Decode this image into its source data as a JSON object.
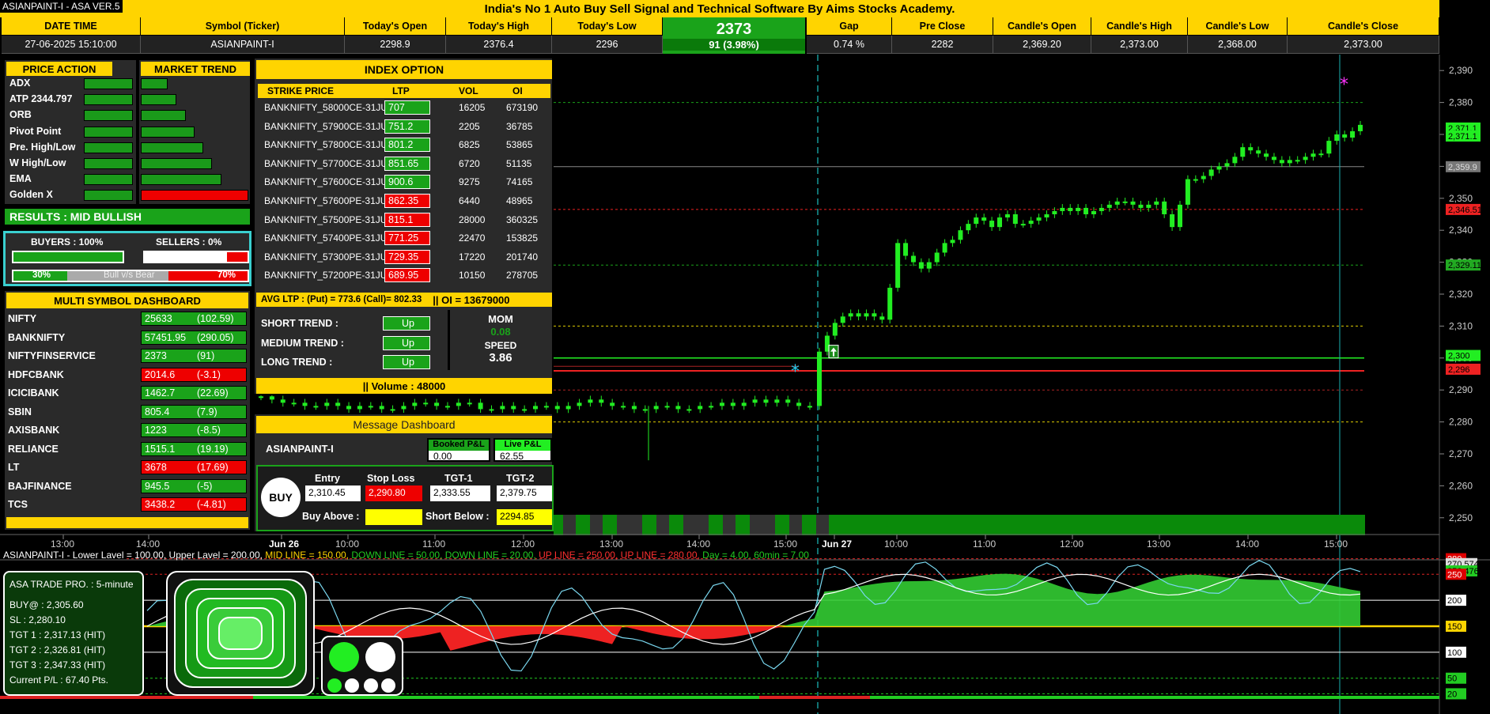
{
  "app": {
    "title": "ASIANPAINT-I - ASA VER.5",
    "banner": "India's No 1 Auto Buy Sell Signal and Technical Software By Aims Stocks Academy."
  },
  "quote": {
    "headers": [
      "DATE TIME",
      "Symbol (Ticker)",
      "Today's Open",
      "Today's High",
      "Today's Low",
      "Gap",
      "Pre Close",
      "Candle's Open",
      "Candle's High",
      "Candle's Low",
      "Candle's Close"
    ],
    "values": [
      "27-06-2025 15:10:00",
      "ASIANPAINT-I",
      "2298.9",
      "2376.4",
      "2296",
      "0.74 %",
      "2282",
      "2,369.20",
      "2,373.00",
      "2,368.00",
      "2,373.00"
    ],
    "ltp": "2373",
    "change": "91 (3.98%)"
  },
  "price_action": {
    "title": "PRICE ACTION",
    "items": [
      "ADX",
      "ATP 2344.797",
      "ORB",
      "Pivot Point",
      "Pre. High/Low",
      "W High/Low",
      "EMA",
      "Golden X"
    ]
  },
  "market_trend": {
    "title": "MARKET TREND",
    "levels": [
      0.25,
      0.33,
      0.42,
      0.5,
      0.58,
      0.66,
      0.75,
      1.0
    ]
  },
  "results": {
    "label": "RESULTS :  MID BULLISH"
  },
  "buyers_sellers": {
    "buyers": "BUYERS : 100%",
    "sellers": "SELLERS :  0%",
    "bull_pct": "30%",
    "bull_label": "Bull v/s Bear",
    "bear_pct": "70%"
  },
  "index_option": {
    "title": "INDEX OPTION",
    "headers": [
      "STRIKE PRICE",
      "LTP",
      "VOL",
      "OI"
    ],
    "rows": [
      {
        "strike": "BANKNIFTY_58000CE-31JU",
        "ltp": "707",
        "vol": "16205",
        "oi": "673190",
        "color": "g"
      },
      {
        "strike": "BANKNIFTY_57900CE-31JU",
        "ltp": "751.2",
        "vol": "2205",
        "oi": "36785",
        "color": "g"
      },
      {
        "strike": "BANKNIFTY_57800CE-31JU",
        "ltp": "801.2",
        "vol": "6825",
        "oi": "53865",
        "color": "g"
      },
      {
        "strike": "BANKNIFTY_57700CE-31JU",
        "ltp": "851.65",
        "vol": "6720",
        "oi": "51135",
        "color": "g"
      },
      {
        "strike": "BANKNIFTY_57600CE-31JU",
        "ltp": "900.6",
        "vol": "9275",
        "oi": "74165",
        "color": "g"
      },
      {
        "strike": "BANKNIFTY_57600PE-31JU",
        "ltp": "862.35",
        "vol": "6440",
        "oi": "48965",
        "color": "r"
      },
      {
        "strike": "BANKNIFTY_57500PE-31JU",
        "ltp": "815.1",
        "vol": "28000",
        "oi": "360325",
        "color": "r"
      },
      {
        "strike": "BANKNIFTY_57400PE-31JU",
        "ltp": "771.25",
        "vol": "22470",
        "oi": "153825",
        "color": "r"
      },
      {
        "strike": "BANKNIFTY_57300PE-31JU",
        "ltp": "729.35",
        "vol": "17220",
        "oi": "201740",
        "color": "r"
      },
      {
        "strike": "BANKNIFTY_57200PE-31JU",
        "ltp": "689.95",
        "vol": "10150",
        "oi": "278705",
        "color": "r"
      }
    ],
    "avg_ltp": "AVG LTP : (Put) = 773.6    (Call)= 802.33",
    "oi_total": "|| OI = 13679000",
    "trends": [
      {
        "label": "SHORT TREND   :",
        "value": "Up"
      },
      {
        "label": "MEDIUM TREND  :",
        "value": "Up"
      },
      {
        "label": "LONG TREND    :",
        "value": "Up"
      }
    ],
    "mom_label": "MOM",
    "mom_value": "0.08",
    "speed_label": "SPEED",
    "speed_value": "3.86",
    "volume": "||  Volume : 48000"
  },
  "multi_symbol": {
    "title": "MULTI SYMBOL DASHBOARD",
    "rows": [
      {
        "sym": "NIFTY",
        "price": "25633",
        "chg": "(102.59)",
        "color": "g"
      },
      {
        "sym": "BANKNIFTY",
        "price": "57451.95",
        "chg": "(290.05)",
        "color": "g"
      },
      {
        "sym": "NIFTYFINSERVICE",
        "price": "2373",
        "chg": "(91)",
        "color": "g"
      },
      {
        "sym": "HDFCBANK",
        "price": "2014.6",
        "chg": "(-3.1)",
        "color": "r"
      },
      {
        "sym": "ICICIBANK",
        "price": "1462.7",
        "chg": "(22.69)",
        "color": "g"
      },
      {
        "sym": "SBIN",
        "price": "805.4",
        "chg": "(7.9)",
        "color": "g"
      },
      {
        "sym": "AXISBANK",
        "price": "1223",
        "chg": "(-8.5)",
        "color": "g"
      },
      {
        "sym": "RELIANCE",
        "price": "1515.1",
        "chg": "(19.19)",
        "color": "g"
      },
      {
        "sym": "LT",
        "price": "3678",
        "chg": "(17.69)",
        "color": "r"
      },
      {
        "sym": "BAJFINANCE",
        "price": "945.5",
        "chg": "(-5)",
        "color": "g"
      },
      {
        "sym": "TCS",
        "price": "3438.2",
        "chg": "(-4.81)",
        "color": "r"
      }
    ]
  },
  "message": {
    "title": "Message Dashboard",
    "symbol": "ASIANPAINT-I",
    "booked_label": "Booked P&L",
    "booked_value": "0.00",
    "live_label": "Live P&L",
    "live_value": "62.55",
    "buy": "BUY",
    "entry_label": "Entry",
    "entry": "2,310.45",
    "sl_label": "Stop Loss",
    "sl": "2,290.80",
    "tgt1_label": "TGT-1",
    "tgt1": "2,333.55",
    "tgt2_label": "TGT-2",
    "tgt2": "2,379.75",
    "buy_above_label": "Buy Above :",
    "buy_above": "",
    "short_below_label": "Short Below :",
    "short_below": "2294.85"
  },
  "trade_pro": {
    "title": "ASA TRADE PRO. : 5-minute",
    "lines": [
      "BUY@    : 2,305.60",
      "SL        : 2,280.10",
      "TGT 1 : 2,317.13 (HIT)",
      "TGT 2 : 2,326.81 (HIT)",
      "TGT 3 : 2,347.33 (HIT)",
      "Current P/L : 67.40 Pts."
    ]
  },
  "indicator_legend": [
    {
      "text": "ASIANPAINT-I - Lower Lavel = 100.00, Upper Lavel = 200.00, ",
      "color": "#ffffff"
    },
    {
      "text": "MID LINE = 150.00, ",
      "color": "#ffd400"
    },
    {
      "text": "DOWN LINE = 50.00, ",
      "color": "#22cc22"
    },
    {
      "text": "DOWN LINE = 20.00, ",
      "color": "#22cc22"
    },
    {
      "text": "UP LINE = 250.00, ",
      "color": "#ff3030"
    },
    {
      "text": "UP LINE = 280.00, ",
      "color": "#ff3030"
    },
    {
      "text": "Day = 4.00, ",
      "color": "#22cc22"
    },
    {
      "text": "60min = 7.00",
      "color": "#22cc22"
    }
  ],
  "chart_data": {
    "type": "candlestick",
    "y_ticks": [
      "2,390",
      "2,380",
      "2,370",
      "2,360",
      "2,350",
      "2,340",
      "2,330",
      "2,320",
      "2,310",
      "2,300",
      "2,290",
      "2,280",
      "2,270",
      "2,260",
      "2,250"
    ],
    "x_ticks": [
      "13:00",
      "14:00",
      "Jun 26",
      "10:00",
      "11:00",
      "12:00",
      "13:00",
      "14:00",
      "15:00",
      "Jun 27",
      "10:00",
      "11:00",
      "12:00",
      "13:00",
      "14:00",
      "15:00"
    ],
    "ylim": [
      2245,
      2395
    ],
    "price_tags": [
      {
        "label": "2,371.1",
        "color": "#22ee22"
      },
      {
        "label": "2,371.1",
        "color": "#22ee22"
      },
      {
        "label": "2,359.9",
        "color": "#777777"
      },
      {
        "label": "2,346.51",
        "color": "#ee2222"
      },
      {
        "label": "2,329.11",
        "color": "#22aa22"
      },
      {
        "label": "2,300",
        "color": "#22ee22"
      },
      {
        "label": "2,296",
        "color": "#ee2222"
      }
    ],
    "closes": [
      2288,
      2287,
      2286,
      2286,
      2285,
      2285,
      2286,
      2285,
      2284,
      2285,
      2285,
      2284,
      2284,
      2285,
      2286,
      2286,
      2285,
      2285,
      2286,
      2286,
      2284,
      2284,
      2285,
      2284,
      2284,
      2285,
      2285,
      2284,
      2285,
      2286,
      2287,
      2286,
      2285,
      2285,
      2284,
      2284,
      2285,
      2285,
      2284,
      2284,
      2285,
      2285,
      2286,
      2285,
      2286,
      2287,
      2286,
      2287,
      2286,
      2285,
      2285,
      2302,
      2307,
      2311,
      2313,
      2314,
      2313,
      2314,
      2313,
      2312,
      2322,
      2336,
      2332,
      2330,
      2328,
      2330,
      2333,
      2336,
      2337,
      2340,
      2342,
      2344,
      2343,
      2341,
      2344,
      2345,
      2342,
      2342,
      2343,
      2344,
      2345,
      2346,
      2347,
      2346,
      2347,
      2345,
      2346,
      2347,
      2348,
      2349,
      2349,
      2348,
      2347,
      2348,
      2349,
      2345,
      2341,
      2348,
      2356,
      2356,
      2357,
      2359,
      2360,
      2361,
      2363,
      2366,
      2365,
      2364,
      2363,
      2362,
      2361,
      2362,
      2362,
      2363,
      2364,
      2364,
      2368,
      2370,
      2369,
      2371,
      2373
    ],
    "osc_ticks": [
      {
        "label": "280",
        "bg": "#dd0000"
      },
      {
        "label": "270.574",
        "bg": "#dddddd"
      },
      {
        "label": "256.476",
        "bg": "#22cc22"
      },
      {
        "label": "250",
        "bg": "#dd0000"
      },
      {
        "label": "200",
        "bg": "#ffffff"
      },
      {
        "label": "150",
        "bg": "#ffd400"
      },
      {
        "label": "100",
        "bg": "#ffffff"
      },
      {
        "label": "50",
        "bg": "#22cc22"
      },
      {
        "label": "20",
        "bg": "#22cc22"
      }
    ]
  }
}
